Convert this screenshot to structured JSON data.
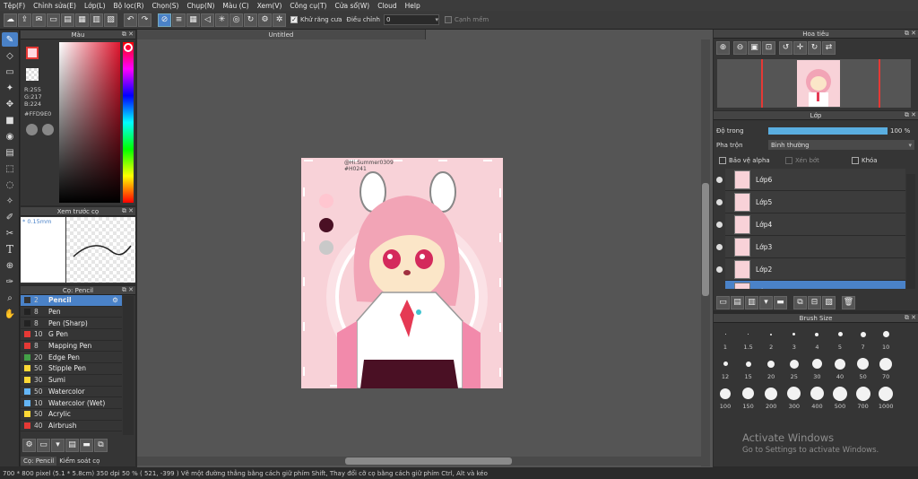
{
  "menu": [
    "Tệp(F)",
    "Chỉnh sửa(E)",
    "Lớp(L)",
    "Bộ lọc(R)",
    "Chọn(S)",
    "Chụp(N)",
    "Màu (C)",
    "Xem(V)",
    "Công cụ(T)",
    "Cửa sổ(W)",
    "Cloud",
    "Help"
  ],
  "toolbar": {
    "antialias_label": "Khử răng cưa",
    "adjust_label": "Điều chỉnh",
    "adjust_value": "0",
    "smooth_label": "Cạnh mềm"
  },
  "color_panel": {
    "title": "Màu",
    "r": "R:255",
    "g": "G:217",
    "b": "B:224",
    "hex": "#FFD9E0",
    "main_color": "#ffd9e0"
  },
  "preview_panel": {
    "title": "Xem trước cọ",
    "size": "* 0.15mm"
  },
  "brush_panel": {
    "title": "Cọ: Pencil",
    "items": [
      {
        "size": "2",
        "name": "Pencil",
        "color": "#333333"
      },
      {
        "size": "8",
        "name": "Pen",
        "color": "#222222"
      },
      {
        "size": "8",
        "name": "Pen (Sharp)",
        "color": "#222222"
      },
      {
        "size": "10",
        "name": "G Pen",
        "color": "#e53935"
      },
      {
        "size": "8",
        "name": "Mapping Pen",
        "color": "#e53935"
      },
      {
        "size": "20",
        "name": "Edge Pen",
        "color": "#43a047"
      },
      {
        "size": "50",
        "name": "Stipple Pen",
        "color": "#fdd835"
      },
      {
        "size": "30",
        "name": "Sumi",
        "color": "#fdd835"
      },
      {
        "size": "50",
        "name": "Watercolor",
        "color": "#64b5f6"
      },
      {
        "size": "10",
        "name": "Watercolor (Wet)",
        "color": "#64b5f6"
      },
      {
        "size": "50",
        "name": "Acrylic",
        "color": "#fdd835"
      },
      {
        "size": "40",
        "name": "Airbrush",
        "color": "#e53935"
      }
    ],
    "tab1": "Cọ: Pencil",
    "tab2": "Kiểm soát cọ"
  },
  "canvas": {
    "title": "Untitled",
    "signature": "@Hi.Summer0309 #H0241"
  },
  "navigator": {
    "title": "Hoa tiêu"
  },
  "layer_panel": {
    "title": "Lớp",
    "opacity_label": "Độ trong",
    "opacity_value": "100 %",
    "opacity": 1.0,
    "blend_label": "Pha trộn",
    "blend_value": "Bình thường",
    "protect_alpha": "Bảo vệ alpha",
    "clip": "Xén bớt",
    "lock": "Khóa",
    "layers": [
      "Lớp6",
      "Lớp5",
      "Lớp4",
      "Lớp3",
      "Lớp2",
      "Lớp1"
    ]
  },
  "brush_size": {
    "title": "Brush Size",
    "sizes": [
      "1",
      "1.5",
      "2",
      "3",
      "4",
      "5",
      "7",
      "10",
      "12",
      "15",
      "20",
      "25",
      "30",
      "40",
      "50",
      "70",
      "100",
      "150",
      "200",
      "300",
      "400",
      "500",
      "700",
      "1000"
    ]
  },
  "watermark": {
    "line1": "Activate Windows",
    "line2": "Go to Settings to activate Windows."
  },
  "status": {
    "dims": "700 * 800 pixel",
    "size": "(5.1 * 5.8cm)",
    "dpi": "350 dpi",
    "zoom": "50 %",
    "coords": "( 521, -399 )",
    "hint": "Vẽ một đường thẳng bằng cách giữ phím Shift, Thay đổi cỡ cọ bằng cách giữ phím Ctrl, Alt và kéo"
  }
}
